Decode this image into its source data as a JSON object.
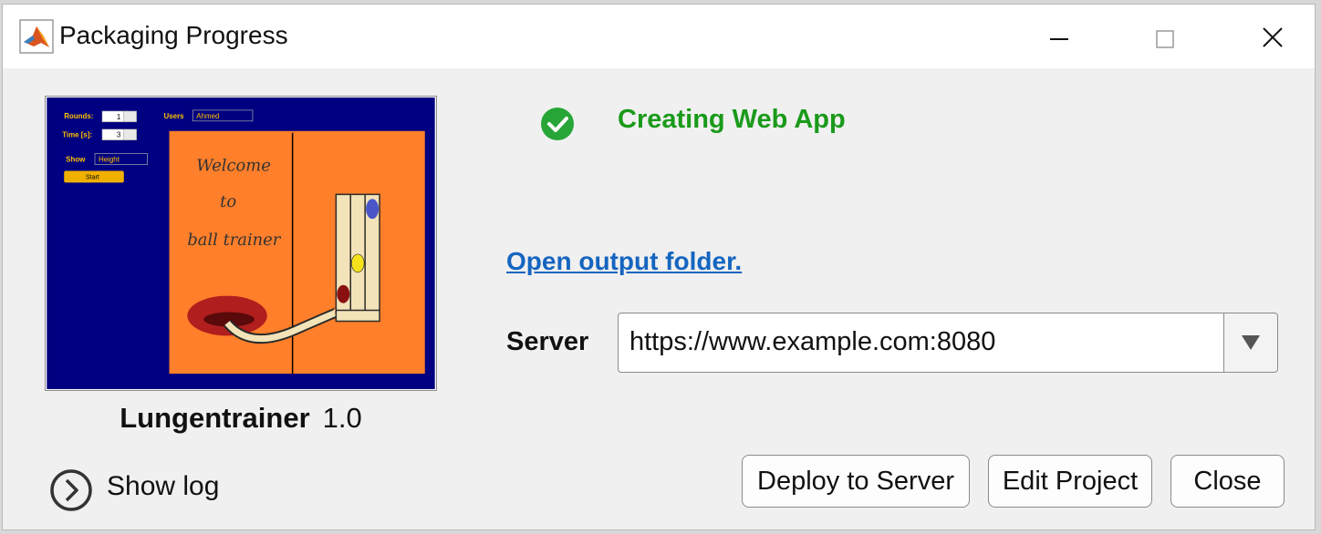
{
  "window": {
    "title": "Packaging Progress",
    "icon": "matlab-icon",
    "controls": [
      "minimize-icon",
      "maximize-icon",
      "close-icon"
    ]
  },
  "app": {
    "name": "Lungentrainer",
    "version": "1.0",
    "preview": {
      "rounds_label": "Rounds:",
      "rounds_value": "1",
      "time_label": "Time [s]:",
      "time_value": "3",
      "users_label": "Users",
      "users_value": "Ahmed",
      "show_label": "Show",
      "show_value": "Height",
      "start_label": "Start",
      "welcome_lines": [
        "Welcome",
        "to",
        "ball trainer"
      ]
    }
  },
  "status": {
    "icon": "check-circle-icon",
    "text": "Creating Web App",
    "color": "#1a9a1a"
  },
  "open_output_link": "Open output folder.",
  "server": {
    "label": "Server",
    "value": "https://www.example.com:8080"
  },
  "show_log": {
    "label": "Show log",
    "icon": "chevron-right-circle-icon"
  },
  "buttons": {
    "deploy": "Deploy to Server",
    "edit": "Edit Project",
    "close": "Close"
  },
  "colors": {
    "link": "#1565c0",
    "preview_bg": "#000080",
    "preview_panel": "#ff7f2a",
    "preview_label": "#ffc000"
  }
}
